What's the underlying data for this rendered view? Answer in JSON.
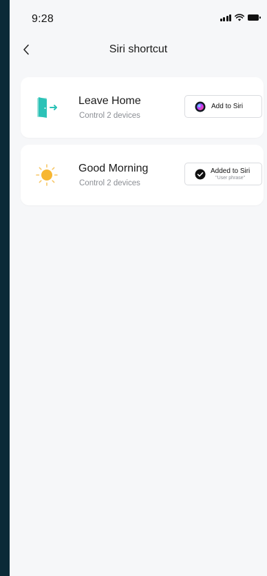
{
  "status_bar": {
    "time": "9:28",
    "icons": [
      "cellular-signal-icon",
      "wifi-icon",
      "battery-icon"
    ]
  },
  "nav": {
    "back_icon": "chevron-left-icon",
    "title": "Siri shortcut"
  },
  "shortcuts": [
    {
      "title": "Leave Home",
      "subtitle": "Control 2 devices",
      "icon": "leave-home-door-icon",
      "button": {
        "label": "Add to Siri",
        "icon": "siri-orb-icon",
        "added": false
      }
    },
    {
      "title": "Good Morning",
      "subtitle": "Control 2 devices",
      "icon": "sun-icon",
      "button": {
        "label": "Added to Siri",
        "phrase": "\"User phrase\"",
        "icon": "checkmark-circle-icon",
        "added": true
      }
    }
  ],
  "colors": {
    "background": "#f6f7f9",
    "outer_frame": "#0b2a37",
    "card": "#ffffff",
    "door_teal": "#2cc2b7",
    "sun_yellow": "#f7b733"
  }
}
